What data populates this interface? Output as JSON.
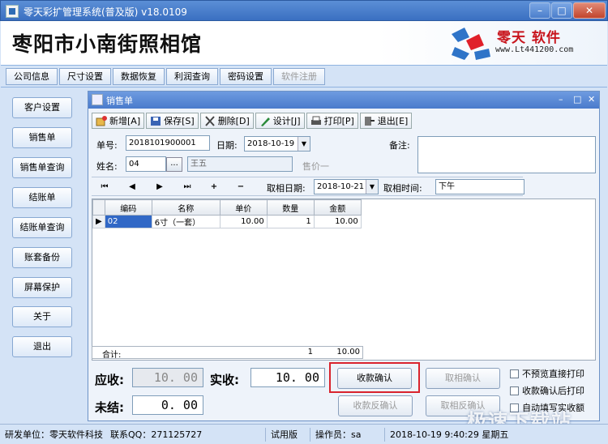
{
  "window": {
    "title": "零天彩扩管理系统(普及版)  v18.0109"
  },
  "banner": {
    "company": "枣阳市小南街照相馆",
    "logo_brand": "零天 软件",
    "logo_url": "www.Lt441200.com"
  },
  "menu_tabs": [
    "公司信息",
    "尺寸设置",
    "数据恢复",
    "利润查询",
    "密码设置",
    "软件注册"
  ],
  "sidebar": [
    "客户设置",
    "销售单",
    "销售单查询",
    "结账单",
    "结账单查询",
    "账套备份",
    "屏幕保护",
    "关于",
    "退出"
  ],
  "sales_window": {
    "title": "销售单",
    "toolbar": [
      "新增[A]",
      "保存[S]",
      "删除[D]",
      "设计[J]",
      "打印[P]",
      "退出[E]"
    ],
    "order_no_label": "单号:",
    "order_no": "2018101900001",
    "date_label": "日期:",
    "date": "2018-10-19",
    "name_label": "姓名:",
    "name_code": "04",
    "name_value": "王五",
    "seller": "售价一",
    "remark_label": "备注:",
    "pickup_date_label": "取相日期:",
    "pickup_date": "2018-10-21",
    "pickup_time_label": "取相时间:",
    "pickup_time": "下午",
    "grid": {
      "columns": [
        "编码",
        "名称",
        "单价",
        "数量",
        "金额"
      ],
      "rows": [
        {
          "code": "02",
          "name": "6寸（一套）",
          "price": "10.00",
          "qty": "1",
          "amount": "10.00"
        }
      ],
      "sum_label": "合计:",
      "sum_qty": "1",
      "sum_amount": "10.00"
    },
    "receivable_label": "应收:",
    "receivable": "10. 00",
    "received_label": "实收:",
    "received": "10. 00",
    "unsettled_label": "未结:",
    "unsettled": "0. 00",
    "buttons": {
      "confirm_payment": "收款确认",
      "reverse_payment": "收款反确认",
      "confirm_pickup": "取相确认",
      "reverse_pickup": "取相反确认"
    },
    "checkboxes": [
      "不预览直接打印",
      "收款确认后打印",
      "自动填写实收额"
    ]
  },
  "status": {
    "developer": "研发单位：零天软件科技",
    "qq": "联系QQ：271125727",
    "edition": "试用版",
    "operator": "操作员：sa",
    "datetime": "2018-10-19 9:40:29 星期五"
  },
  "watermark": "极速下载站",
  "colors": {
    "title_blue": "#3a6fc1",
    "highlight_red": "#d9232d",
    "selection_blue": "#3168c6"
  }
}
